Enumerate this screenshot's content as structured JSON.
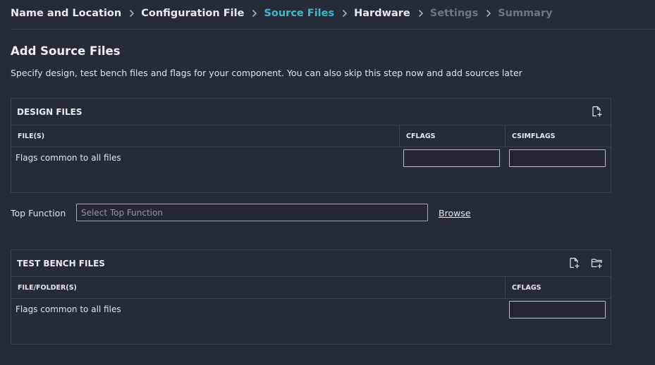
{
  "wizard": {
    "steps": [
      {
        "label": "Name and Location",
        "state": "done"
      },
      {
        "label": "Configuration File",
        "state": "done"
      },
      {
        "label": "Source Files",
        "state": "active"
      },
      {
        "label": "Hardware",
        "state": "done"
      },
      {
        "label": "Settings",
        "state": "disabled"
      },
      {
        "label": "Summary",
        "state": "disabled"
      }
    ]
  },
  "page": {
    "title": "Add Source Files",
    "description": "Specify design, test bench files and flags for your component. You can also skip this step now and add sources later"
  },
  "design_files": {
    "title": "DESIGN FILES",
    "columns": [
      "FILE(S)",
      "CFLAGS",
      "CSIMFLAGS"
    ],
    "common_row_label": "Flags common to all files",
    "cflags_value": "",
    "csimflags_value": "",
    "tools": [
      "add-file-icon"
    ]
  },
  "top_function": {
    "label": "Top Function",
    "placeholder": "Select Top Function",
    "value": "",
    "browse_label": "Browse"
  },
  "test_bench_files": {
    "title": "TEST BENCH FILES",
    "columns": [
      "FILE/FOLDER(S)",
      "CFLAGS"
    ],
    "common_row_label": "Flags common to all files",
    "cflags_value": "",
    "tools": [
      "add-file-icon",
      "add-folder-icon"
    ]
  },
  "colors": {
    "background": "#262b38",
    "accent": "#3fb8c9",
    "disabled": "#6f7584"
  }
}
